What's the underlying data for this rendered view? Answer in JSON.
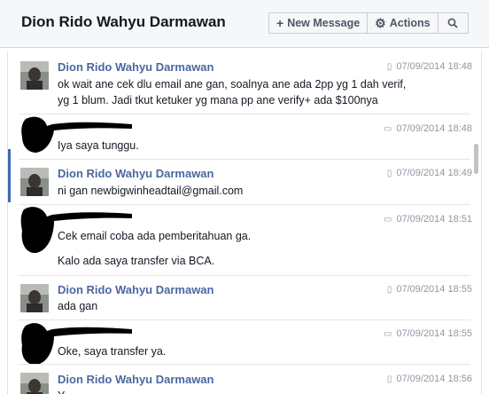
{
  "header": {
    "title": "Dion Rido Wahyu Darmawan",
    "new_message_label": "New Message",
    "actions_label": "Actions"
  },
  "icons": {
    "plus": "plus-icon",
    "gear": "gear-icon",
    "search": "search-icon",
    "mobile": "mobile-phone-icon",
    "chat": "chat-bubble-icon"
  },
  "colors": {
    "name_link": "#4b67a1",
    "meta_text": "#9197a3",
    "header_bg": "#f6f7f9"
  },
  "messages": [
    {
      "sender": "Dion Rido Wahyu Darmawan",
      "timestamp": "07/09/2014 18:48",
      "source": "mobile",
      "lines": [
        "ok wait ane cek dlu email ane gan, soalnya ane ada 2pp yg 1 dah verif,",
        "yg 1 blum. Jadi tkut ketuker yg mana pp ane verify+ ada $100nya"
      ]
    },
    {
      "sender": "",
      "timestamp": "07/09/2014 18:48",
      "source": "chat",
      "lines": [
        "Iya saya tunggu."
      ]
    },
    {
      "sender": "Dion Rido Wahyu Darmawan",
      "timestamp": "07/09/2014 18:49",
      "source": "mobile",
      "lines": [
        "ni gan newbigwinheadtail@gmail.com"
      ]
    },
    {
      "sender": "",
      "timestamp": "07/09/2014 18:51",
      "source": "chat",
      "lines": [
        "Cek email coba ada pemberitahuan ga.",
        "Kalo ada saya transfer via BCA."
      ]
    },
    {
      "sender": "Dion Rido Wahyu Darmawan",
      "timestamp": "07/09/2014 18:55",
      "source": "mobile",
      "lines": [
        "ada gan"
      ]
    },
    {
      "sender": "",
      "timestamp": "07/09/2014 18:55",
      "source": "chat",
      "lines": [
        "Oke, saya transfer ya."
      ]
    },
    {
      "sender": "Dion Rido Wahyu Darmawan",
      "timestamp": "07/09/2014 18:56",
      "source": "mobile",
      "lines": [
        "Y"
      ]
    }
  ]
}
